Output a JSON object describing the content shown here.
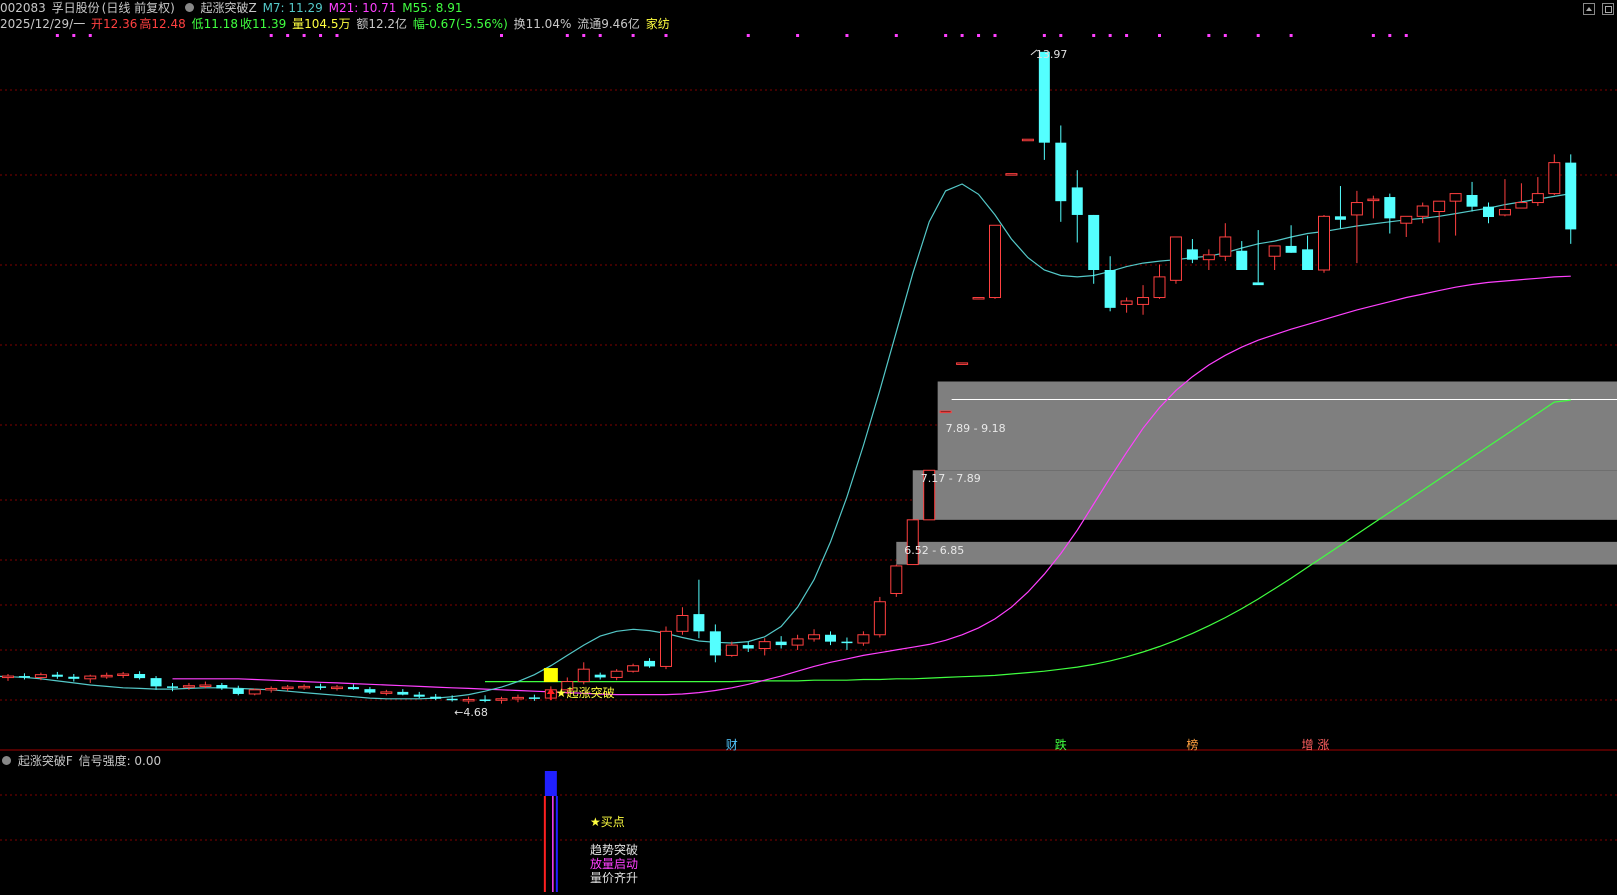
{
  "header": {
    "code": "002083",
    "name": "孚日股份",
    "period": "(日线 前复权)",
    "indicator_name": "起涨突破Z",
    "ma7_label": "M7: 11.29",
    "ma21_label": "M21: 10.71",
    "ma55_label": "M55: 8.91",
    "date": "2025/12/29/一",
    "open": "开12.36",
    "high": "高12.48",
    "low": "低11.18",
    "close": "收11.39",
    "volume": "量104.5万",
    "amount": "额12.2亿",
    "change": "幅-0.67(-5.56%)",
    "turnover": "换11.04%",
    "float_cap": "流通9.46亿",
    "sector": "家纺"
  },
  "colors": {
    "background": "#000000",
    "up": "#ff4040",
    "down": "#54ffff",
    "ma7": "#54c8c8",
    "ma21": "#ff40ff",
    "ma55": "#40ff40",
    "grid": "#800000",
    "zone": "#7f7f7f",
    "marker": "#ff40ff"
  },
  "chart_data": {
    "type": "candlestick",
    "price_range": [
      4.0,
      14.2
    ],
    "ohlc": [
      [
        4.88,
        4.93,
        4.83,
        4.9
      ],
      [
        4.9,
        4.94,
        4.85,
        4.88
      ],
      [
        4.88,
        4.95,
        4.84,
        4.92
      ],
      [
        4.92,
        4.96,
        4.86,
        4.89
      ],
      [
        4.89,
        4.93,
        4.82,
        4.86
      ],
      [
        4.86,
        4.92,
        4.8,
        4.9
      ],
      [
        4.9,
        4.95,
        4.86,
        4.91
      ],
      [
        4.91,
        4.96,
        4.87,
        4.93
      ],
      [
        4.93,
        4.97,
        4.85,
        4.87
      ],
      [
        4.87,
        4.9,
        4.7,
        4.75
      ],
      [
        4.75,
        4.8,
        4.68,
        4.74
      ],
      [
        4.74,
        4.8,
        4.7,
        4.76
      ],
      [
        4.76,
        4.82,
        4.72,
        4.77
      ],
      [
        4.77,
        4.8,
        4.7,
        4.72
      ],
      [
        4.72,
        4.76,
        4.62,
        4.64
      ],
      [
        4.64,
        4.72,
        4.62,
        4.7
      ],
      [
        4.7,
        4.75,
        4.66,
        4.72
      ],
      [
        4.72,
        4.77,
        4.68,
        4.74
      ],
      [
        4.74,
        4.78,
        4.7,
        4.75
      ],
      [
        4.75,
        4.79,
        4.7,
        4.73
      ],
      [
        4.73,
        4.77,
        4.69,
        4.74
      ],
      [
        4.74,
        4.78,
        4.7,
        4.71
      ],
      [
        4.71,
        4.74,
        4.64,
        4.66
      ],
      [
        4.66,
        4.7,
        4.62,
        4.67
      ],
      [
        4.67,
        4.71,
        4.62,
        4.63
      ],
      [
        4.63,
        4.67,
        4.58,
        4.6
      ],
      [
        4.6,
        4.64,
        4.55,
        4.57
      ],
      [
        4.57,
        4.62,
        4.53,
        4.55
      ],
      [
        4.55,
        4.6,
        4.5,
        4.56
      ],
      [
        4.56,
        4.62,
        4.52,
        4.55
      ],
      [
        4.55,
        4.6,
        4.5,
        4.57
      ],
      [
        4.57,
        4.63,
        4.52,
        4.59
      ],
      [
        4.59,
        4.63,
        4.54,
        4.58
      ],
      [
        4.58,
        4.75,
        4.55,
        4.7
      ],
      [
        4.7,
        4.88,
        4.64,
        4.82
      ],
      [
        4.82,
        5.1,
        4.78,
        5.0
      ],
      [
        4.92,
        4.95,
        4.85,
        4.88
      ],
      [
        4.88,
        5.0,
        4.84,
        4.97
      ],
      [
        4.97,
        5.08,
        4.95,
        5.05
      ],
      [
        5.12,
        5.16,
        5.02,
        5.04
      ],
      [
        5.04,
        5.62,
        5.0,
        5.55
      ],
      [
        5.55,
        5.9,
        5.5,
        5.78
      ],
      [
        5.8,
        6.3,
        5.45,
        5.55
      ],
      [
        5.55,
        5.65,
        5.1,
        5.2
      ],
      [
        5.2,
        5.4,
        5.18,
        5.35
      ],
      [
        5.35,
        5.4,
        5.25,
        5.3
      ],
      [
        5.3,
        5.45,
        5.2,
        5.4
      ],
      [
        5.4,
        5.48,
        5.3,
        5.35
      ],
      [
        5.35,
        5.5,
        5.28,
        5.44
      ],
      [
        5.44,
        5.58,
        5.4,
        5.5
      ],
      [
        5.5,
        5.55,
        5.35,
        5.4
      ],
      [
        5.4,
        5.46,
        5.28,
        5.38
      ],
      [
        5.38,
        5.55,
        5.34,
        5.5
      ],
      [
        5.5,
        6.05,
        5.46,
        5.98
      ],
      [
        6.1,
        6.52,
        6.05,
        6.5
      ],
      [
        6.52,
        7.17,
        6.52,
        7.17
      ],
      [
        7.17,
        7.89,
        7.17,
        7.89
      ],
      [
        8.75,
        8.75,
        8.75,
        8.75
      ],
      [
        9.45,
        9.45,
        9.45,
        9.45
      ],
      [
        10.4,
        10.4,
        10.4,
        10.4
      ],
      [
        10.4,
        11.45,
        10.38,
        11.45
      ],
      [
        12.2,
        12.2,
        12.2,
        12.2
      ],
      [
        12.7,
        12.7,
        12.7,
        12.7
      ],
      [
        13.97,
        13.97,
        12.4,
        12.65
      ],
      [
        12.65,
        12.9,
        11.5,
        11.8
      ],
      [
        12.0,
        12.25,
        11.2,
        11.6
      ],
      [
        11.6,
        11.6,
        10.6,
        10.8
      ],
      [
        10.8,
        11.0,
        10.2,
        10.25
      ],
      [
        10.3,
        10.4,
        10.18,
        10.35
      ],
      [
        10.3,
        10.58,
        10.15,
        10.4
      ],
      [
        10.4,
        10.88,
        10.38,
        10.7
      ],
      [
        10.65,
        11.27,
        10.6,
        11.28
      ],
      [
        11.1,
        11.25,
        10.9,
        10.95
      ],
      [
        10.95,
        11.1,
        10.8,
        11.02
      ],
      [
        11.0,
        11.48,
        10.93,
        11.28
      ],
      [
        11.08,
        11.22,
        10.92,
        10.8
      ],
      [
        10.62,
        11.38,
        10.62,
        10.58
      ],
      [
        11.0,
        11.1,
        10.8,
        11.15
      ],
      [
        11.15,
        11.45,
        11.05,
        11.05
      ],
      [
        11.1,
        11.3,
        10.9,
        10.8
      ],
      [
        10.8,
        11.6,
        10.76,
        11.58
      ],
      [
        11.58,
        12.02,
        11.4,
        11.53
      ],
      [
        11.6,
        11.95,
        10.9,
        11.78
      ],
      [
        11.82,
        11.88,
        11.55,
        11.83
      ],
      [
        11.86,
        11.91,
        11.33,
        11.55
      ],
      [
        11.48,
        11.52,
        11.28,
        11.58
      ],
      [
        11.58,
        11.78,
        11.48,
        11.73
      ],
      [
        11.65,
        11.73,
        11.2,
        11.8
      ],
      [
        11.8,
        11.8,
        11.3,
        11.91
      ],
      [
        11.89,
        12.08,
        11.65,
        11.72
      ],
      [
        11.72,
        11.78,
        11.48,
        11.57
      ],
      [
        11.6,
        12.12,
        11.58,
        11.68
      ],
      [
        11.7,
        12.06,
        11.73,
        11.78
      ],
      [
        11.78,
        12.15,
        11.73,
        11.91
      ],
      [
        11.91,
        12.48,
        11.89,
        12.36
      ],
      [
        12.36,
        12.48,
        11.18,
        11.39
      ]
    ],
    "ma7": [
      4.88,
      4.89,
      4.9,
      4.9,
      4.89,
      4.88,
      4.86,
      4.83,
      4.8,
      4.77,
      4.75,
      4.73,
      4.72,
      4.71,
      4.71,
      4.72,
      4.73,
      4.73,
      4.72,
      4.71,
      4.7,
      4.68,
      4.66,
      4.64,
      4.62,
      4.6,
      4.58,
      4.57,
      4.57,
      4.57,
      4.58,
      4.6,
      4.63,
      4.68,
      4.74,
      4.82,
      4.92,
      5.05,
      5.2,
      5.35,
      5.48,
      5.55,
      5.58,
      5.56,
      5.52,
      5.46,
      5.41,
      5.39,
      5.38,
      5.4,
      5.47,
      5.62,
      5.9,
      6.3,
      6.85,
      7.5,
      8.25,
      9.05,
      9.9,
      10.75,
      11.5,
      11.95,
      12.05,
      11.9,
      11.6,
      11.25,
      10.98,
      10.8,
      10.72,
      10.7,
      10.72,
      10.78,
      10.85,
      10.9,
      10.93,
      10.95,
      10.98,
      11.0,
      11.05,
      11.12,
      11.18,
      11.22,
      11.28,
      11.33,
      11.36,
      11.4,
      11.44,
      11.47,
      11.5,
      11.53,
      11.55,
      11.58,
      11.62,
      11.66,
      11.7,
      11.75,
      11.79,
      11.83,
      11.87,
      11.91
    ],
    "ma21": [
      4.86,
      4.86,
      4.86,
      4.86,
      4.86,
      4.85,
      4.84,
      4.83,
      4.82,
      4.81,
      4.8,
      4.79,
      4.78,
      4.77,
      4.76,
      4.75,
      4.74,
      4.73,
      4.72,
      4.71,
      4.7,
      4.69,
      4.68,
      4.67,
      4.66,
      4.65,
      4.64,
      4.63,
      4.63,
      4.63,
      4.63,
      4.64,
      4.66,
      4.69,
      4.73,
      4.78,
      4.84,
      4.9,
      4.97,
      5.04,
      5.1,
      5.15,
      5.2,
      5.24,
      5.28,
      5.32,
      5.36,
      5.42,
      5.5,
      5.6,
      5.73,
      5.9,
      6.12,
      6.38,
      6.68,
      7.02,
      7.4,
      7.78,
      8.15,
      8.5,
      8.8,
      9.05,
      9.25,
      9.42,
      9.56,
      9.68,
      9.78,
      9.86,
      9.94,
      10.01,
      10.08,
      10.15,
      10.22,
      10.28,
      10.34,
      10.4,
      10.45,
      10.5,
      10.55,
      10.59,
      10.62,
      10.64,
      10.66,
      10.68,
      10.7,
      10.71
    ],
    "ma55": [
      4.82,
      4.82,
      4.82,
      4.82,
      4.82,
      4.82,
      4.82,
      4.82,
      4.82,
      4.82,
      4.82,
      4.82,
      4.82,
      4.82,
      4.82,
      4.82,
      4.83,
      4.83,
      4.83,
      4.83,
      4.84,
      4.84,
      4.84,
      4.85,
      4.85,
      4.86,
      4.86,
      4.87,
      4.88,
      4.89,
      4.9,
      4.91,
      4.93,
      4.95,
      4.97,
      5.0,
      5.03,
      5.07,
      5.12,
      5.18,
      5.25,
      5.33,
      5.42,
      5.52,
      5.63,
      5.75,
      5.88,
      6.02,
      6.17,
      6.32,
      6.48,
      6.64,
      6.8,
      6.96,
      7.12,
      7.28,
      7.44,
      7.6,
      7.76,
      7.92,
      8.08,
      8.24,
      8.4,
      8.56,
      8.72,
      8.88,
      8.91
    ],
    "zones": [
      {
        "label": "7.89 - 9.18",
        "low": 7.89,
        "high": 9.18
      },
      {
        "label": "7.17 - 7.89",
        "low": 7.17,
        "high": 7.89
      },
      {
        "label": "6.52 - 6.85",
        "low": 6.52,
        "high": 6.85
      }
    ],
    "annotations": {
      "high_label": "13.97",
      "low_label": "4.68",
      "signal_label": "起涨突破"
    },
    "event_tags": [
      {
        "text": "财",
        "color": "#54c8ff",
        "index": 44
      },
      {
        "text": "跌",
        "color": "#40ff40",
        "index": 64
      },
      {
        "text": "榜",
        "color": "#ffa040",
        "index": 72
      },
      {
        "text": "增 涨",
        "color": "#ff6060",
        "index": 79
      }
    ],
    "signal_index": 33,
    "top_marker_indices": [
      3,
      4,
      5,
      16,
      17,
      18,
      19,
      20,
      30,
      34,
      35,
      36,
      38,
      40,
      45,
      48,
      51,
      54,
      57,
      58,
      59,
      60,
      63,
      64,
      66,
      67,
      68,
      70,
      73,
      74,
      76,
      78,
      83,
      84,
      85
    ]
  },
  "subpanel": {
    "title": "起涨突破F",
    "strength_label": "信号强度: 0.00",
    "signals": [
      "★买点",
      "趋势突破",
      "放量启动",
      "量价齐升"
    ]
  }
}
